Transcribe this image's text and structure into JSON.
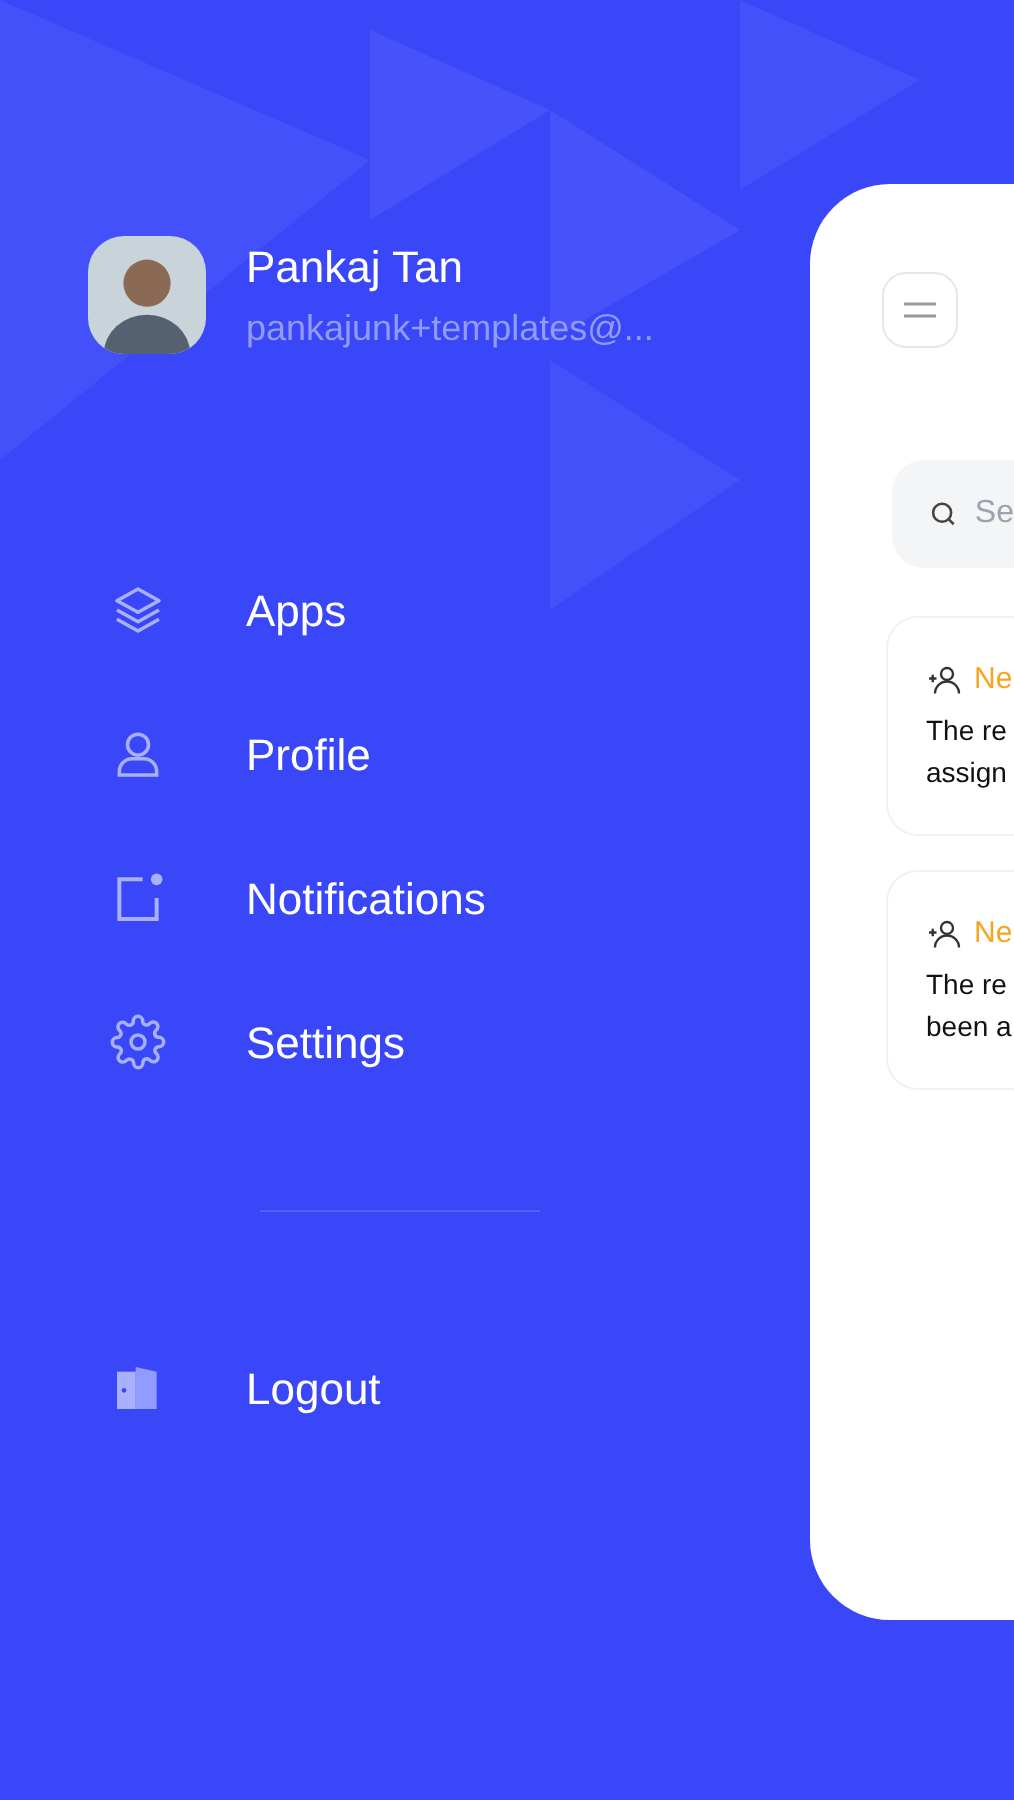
{
  "user": {
    "name": "Pankaj Tan",
    "email": "pankajunk+templates@..."
  },
  "menu": [
    {
      "kind": "apps",
      "label": "Apps"
    },
    {
      "kind": "profile",
      "label": "Profile"
    },
    {
      "kind": "notifications",
      "label": "Notifications"
    },
    {
      "kind": "settings",
      "label": "Settings"
    }
  ],
  "logout": {
    "label": "Logout"
  },
  "main": {
    "search": {
      "placeholder": "Se"
    },
    "notifications": [
      {
        "title": "Ne",
        "lines": [
          "The re",
          "assign"
        ]
      },
      {
        "title": "Ne",
        "lines": [
          "The re",
          "been a"
        ]
      }
    ]
  }
}
